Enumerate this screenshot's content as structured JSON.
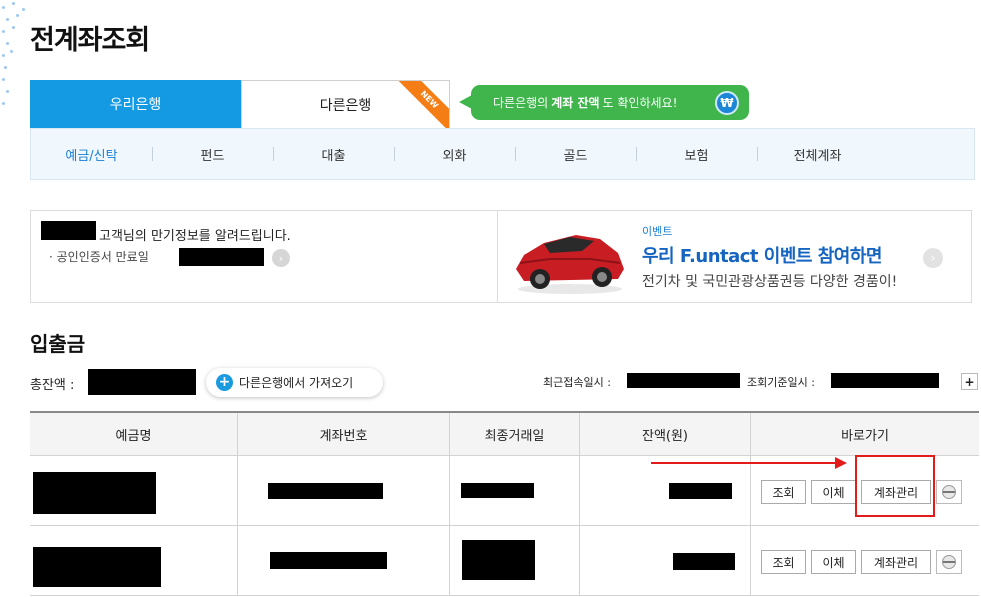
{
  "page": {
    "title": "전계좌조회"
  },
  "bank_tabs": [
    {
      "label": "우리은행",
      "active": true
    },
    {
      "label": "다른은행",
      "active": false,
      "badge": "NEW"
    }
  ],
  "promo": {
    "prefix": "다른은행의",
    "bold": "계좌 잔액",
    "suffix": "도 확인하세요!",
    "icon": "won-icon",
    "icon_text": "₩"
  },
  "categories": [
    "예금/신탁",
    "펀드",
    "대출",
    "외화",
    "골드",
    "보험",
    "전체계좌"
  ],
  "info": {
    "greeting": "고객님의 만기정보를 알려드립니다.",
    "cert_label": "· 공인인증서 만료일",
    "event_label": "이벤트",
    "event_title": "우리 F.untact 이벤트 참여하면",
    "event_desc": "전기차 및 국민관광상품권등 다양한 경품이!"
  },
  "section": {
    "title": "입출금",
    "total_label": "총잔액 :",
    "fetch_label": "다른은행에서 가져오기",
    "recent_label": "최근접속일시 :",
    "query_label": "조회기준일시 :",
    "expand": "+"
  },
  "table": {
    "headers": [
      "예금명",
      "계좌번호",
      "최종거래일",
      "잔액(원)",
      "바로가기"
    ],
    "actions": [
      "조회",
      "이체",
      "계좌관리"
    ]
  },
  "colors": {
    "primary": "#139ae3",
    "promo": "#3fb54c",
    "badge": "#f57d15",
    "highlight": "#e21b1b"
  }
}
